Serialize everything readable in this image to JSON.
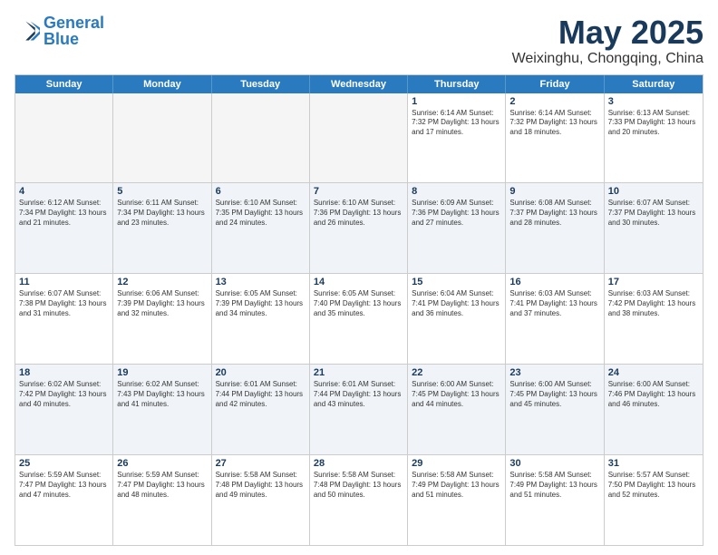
{
  "logo": {
    "line1": "General",
    "line2": "Blue"
  },
  "title": "May 2025",
  "subtitle": "Weixinghu, Chongqing, China",
  "days": [
    "Sunday",
    "Monday",
    "Tuesday",
    "Wednesday",
    "Thursday",
    "Friday",
    "Saturday"
  ],
  "weeks": [
    [
      {
        "day": "",
        "info": "",
        "empty": true
      },
      {
        "day": "",
        "info": "",
        "empty": true
      },
      {
        "day": "",
        "info": "",
        "empty": true
      },
      {
        "day": "",
        "info": "",
        "empty": true
      },
      {
        "day": "1",
        "info": "Sunrise: 6:14 AM\nSunset: 7:32 PM\nDaylight: 13 hours\nand 17 minutes."
      },
      {
        "day": "2",
        "info": "Sunrise: 6:14 AM\nSunset: 7:32 PM\nDaylight: 13 hours\nand 18 minutes."
      },
      {
        "day": "3",
        "info": "Sunrise: 6:13 AM\nSunset: 7:33 PM\nDaylight: 13 hours\nand 20 minutes."
      }
    ],
    [
      {
        "day": "4",
        "info": "Sunrise: 6:12 AM\nSunset: 7:34 PM\nDaylight: 13 hours\nand 21 minutes."
      },
      {
        "day": "5",
        "info": "Sunrise: 6:11 AM\nSunset: 7:34 PM\nDaylight: 13 hours\nand 23 minutes."
      },
      {
        "day": "6",
        "info": "Sunrise: 6:10 AM\nSunset: 7:35 PM\nDaylight: 13 hours\nand 24 minutes."
      },
      {
        "day": "7",
        "info": "Sunrise: 6:10 AM\nSunset: 7:36 PM\nDaylight: 13 hours\nand 26 minutes."
      },
      {
        "day": "8",
        "info": "Sunrise: 6:09 AM\nSunset: 7:36 PM\nDaylight: 13 hours\nand 27 minutes."
      },
      {
        "day": "9",
        "info": "Sunrise: 6:08 AM\nSunset: 7:37 PM\nDaylight: 13 hours\nand 28 minutes."
      },
      {
        "day": "10",
        "info": "Sunrise: 6:07 AM\nSunset: 7:37 PM\nDaylight: 13 hours\nand 30 minutes."
      }
    ],
    [
      {
        "day": "11",
        "info": "Sunrise: 6:07 AM\nSunset: 7:38 PM\nDaylight: 13 hours\nand 31 minutes."
      },
      {
        "day": "12",
        "info": "Sunrise: 6:06 AM\nSunset: 7:39 PM\nDaylight: 13 hours\nand 32 minutes."
      },
      {
        "day": "13",
        "info": "Sunrise: 6:05 AM\nSunset: 7:39 PM\nDaylight: 13 hours\nand 34 minutes."
      },
      {
        "day": "14",
        "info": "Sunrise: 6:05 AM\nSunset: 7:40 PM\nDaylight: 13 hours\nand 35 minutes."
      },
      {
        "day": "15",
        "info": "Sunrise: 6:04 AM\nSunset: 7:41 PM\nDaylight: 13 hours\nand 36 minutes."
      },
      {
        "day": "16",
        "info": "Sunrise: 6:03 AM\nSunset: 7:41 PM\nDaylight: 13 hours\nand 37 minutes."
      },
      {
        "day": "17",
        "info": "Sunrise: 6:03 AM\nSunset: 7:42 PM\nDaylight: 13 hours\nand 38 minutes."
      }
    ],
    [
      {
        "day": "18",
        "info": "Sunrise: 6:02 AM\nSunset: 7:42 PM\nDaylight: 13 hours\nand 40 minutes."
      },
      {
        "day": "19",
        "info": "Sunrise: 6:02 AM\nSunset: 7:43 PM\nDaylight: 13 hours\nand 41 minutes."
      },
      {
        "day": "20",
        "info": "Sunrise: 6:01 AM\nSunset: 7:44 PM\nDaylight: 13 hours\nand 42 minutes."
      },
      {
        "day": "21",
        "info": "Sunrise: 6:01 AM\nSunset: 7:44 PM\nDaylight: 13 hours\nand 43 minutes."
      },
      {
        "day": "22",
        "info": "Sunrise: 6:00 AM\nSunset: 7:45 PM\nDaylight: 13 hours\nand 44 minutes."
      },
      {
        "day": "23",
        "info": "Sunrise: 6:00 AM\nSunset: 7:45 PM\nDaylight: 13 hours\nand 45 minutes."
      },
      {
        "day": "24",
        "info": "Sunrise: 6:00 AM\nSunset: 7:46 PM\nDaylight: 13 hours\nand 46 minutes."
      }
    ],
    [
      {
        "day": "25",
        "info": "Sunrise: 5:59 AM\nSunset: 7:47 PM\nDaylight: 13 hours\nand 47 minutes."
      },
      {
        "day": "26",
        "info": "Sunrise: 5:59 AM\nSunset: 7:47 PM\nDaylight: 13 hours\nand 48 minutes."
      },
      {
        "day": "27",
        "info": "Sunrise: 5:58 AM\nSunset: 7:48 PM\nDaylight: 13 hours\nand 49 minutes."
      },
      {
        "day": "28",
        "info": "Sunrise: 5:58 AM\nSunset: 7:48 PM\nDaylight: 13 hours\nand 50 minutes."
      },
      {
        "day": "29",
        "info": "Sunrise: 5:58 AM\nSunset: 7:49 PM\nDaylight: 13 hours\nand 51 minutes."
      },
      {
        "day": "30",
        "info": "Sunrise: 5:58 AM\nSunset: 7:49 PM\nDaylight: 13 hours\nand 51 minutes."
      },
      {
        "day": "31",
        "info": "Sunrise: 5:57 AM\nSunset: 7:50 PM\nDaylight: 13 hours\nand 52 minutes."
      }
    ]
  ]
}
